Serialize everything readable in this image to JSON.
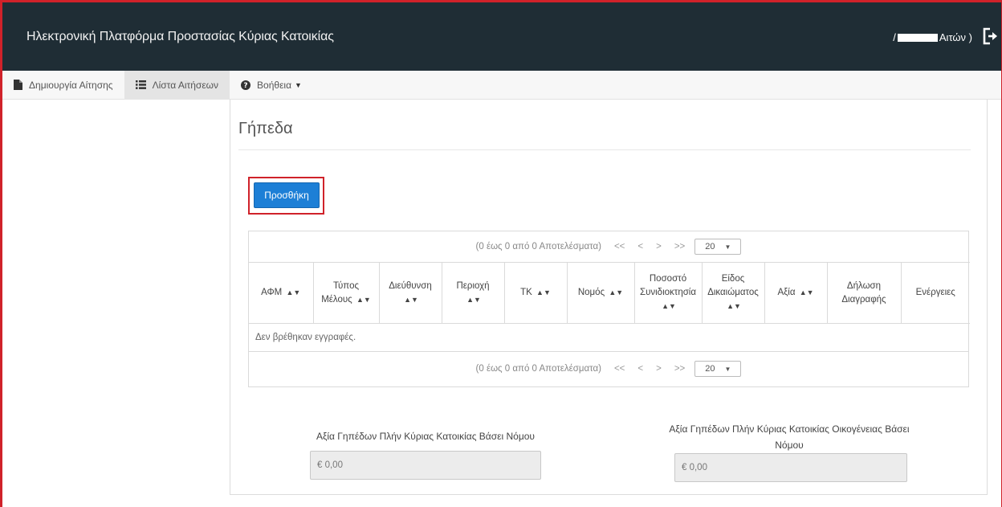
{
  "header": {
    "title": "Ηλεκτρονική Πλατφόρμα Προστασίας Κύριας Κατοικίας",
    "user_prefix": "/",
    "user_suffix": "Αιτών )",
    "logout_icon": "logout-icon"
  },
  "nav": {
    "items": [
      {
        "label": "Δημιουργία Αίτησης",
        "icon": "file-icon"
      },
      {
        "label": "Λίστα Αιτήσεων",
        "icon": "list-icon"
      },
      {
        "label": "Βοήθεια",
        "icon": "help-icon"
      }
    ]
  },
  "panel": {
    "title": "Γήπεδα",
    "add_button": "Προσθήκη"
  },
  "grid": {
    "pager_summary": "(0 έως 0 από 0 Αποτελέσματα)",
    "first": "<<",
    "prev": "<",
    "next": ">",
    "last": ">>",
    "page_size": "20",
    "columns": [
      {
        "line1": "ΑΦΜ",
        "line2": "",
        "line3": ""
      },
      {
        "line1": "Τύπος",
        "line2": "Μέλους",
        "line3": ""
      },
      {
        "line1": "Διεύθυνση",
        "line2": "",
        "line3": ""
      },
      {
        "line1": "Περιοχή",
        "line2": "",
        "line3": ""
      },
      {
        "line1": "ΤΚ",
        "line2": "",
        "line3": ""
      },
      {
        "line1": "Νομός",
        "line2": "",
        "line3": ""
      },
      {
        "line1": "Ποσοστό",
        "line2": "Συνιδιοκτησία",
        "line3": ""
      },
      {
        "line1": "Είδος",
        "line2": "Δικαιώματος",
        "line3": ""
      },
      {
        "line1": "Αξία",
        "line2": "",
        "line3": ""
      },
      {
        "line1": "Δήλωση",
        "line2": "Διαγραφής",
        "line3": ""
      },
      {
        "line1": "Ενέργειες",
        "line2": "",
        "line3": ""
      }
    ],
    "empty_message": "Δεν βρέθηκαν εγγραφές."
  },
  "summary": {
    "left_label": "Αξία Γηπέδων Πλήν Κύριας Κατοικίας Βάσει Νόμου",
    "left_value": "€ 0,00",
    "right_label_line1": "Αξία Γηπέδων Πλήν Κύριας Κατοικίας Οικογένειας Βάσει",
    "right_label_line2": "Νόμου",
    "right_value": "€ 0,00"
  },
  "colors": {
    "header_bg": "#1f2d35",
    "primary": "#1d7fd6",
    "highlight": "#d0222a"
  }
}
